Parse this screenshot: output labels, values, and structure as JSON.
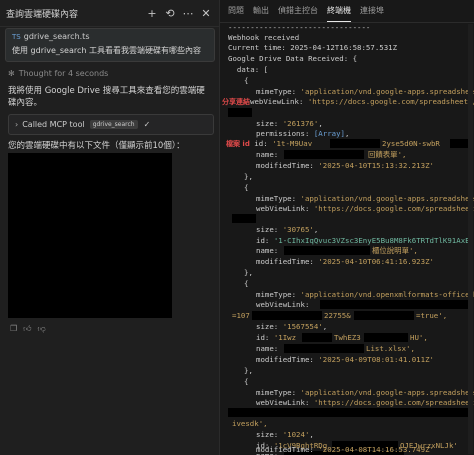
{
  "left": {
    "title": "查詢雲端硬碟內容",
    "icons": [
      "plus-icon",
      "history-icon",
      "more-icon",
      "close-icon"
    ],
    "user_message": {
      "file": "gdrive_search.ts",
      "text": "使用 gdrive_search 工具看看我雲端硬碟有哪些內容"
    },
    "thought": "Thought for 4 seconds",
    "para1": "我將使用 Google Drive 搜尋工具來查看您的雲端硬碟內容。",
    "mcp": {
      "label": "Called MCP tool",
      "tag": "gdrive_search"
    },
    "para2": "您的雲端硬碟中有以下文件（僅顯示前10個）："
  },
  "tabs": [
    {
      "label": "問題",
      "active": false
    },
    {
      "label": "輸出",
      "active": false
    },
    {
      "label": "偵錯主控台",
      "active": false
    },
    {
      "label": "終端機",
      "active": true
    },
    {
      "label": "連接埠",
      "active": false
    }
  ],
  "terminal": {
    "separator": "--------------------------------",
    "l_webhook": "Webhook received",
    "l_time": "Current time: 2025-04-12T16:58:57.531Z",
    "l_gd": "Google Drive Data Received: {",
    "l_data": "  data: [",
    "annotation_share": "分享連結",
    "annotation_id": "檔案 id",
    "f1": {
      "mime": "'application/vnd.google-apps.spreadsheet'",
      "link": "'https://docs.google.com/spreadsheets/",
      "size": "'261376'",
      "perm": "[Array]",
      "id_a": "'1t-M9Uav",
      "id_b": "2yse5d0N-swbR",
      "name": "回饋表單',",
      "mod": "'2025-04-10T15:13:32.213Z'"
    },
    "f2": {
      "mime": "'application/vnd.google-apps.spreadsheet'",
      "link": "'https://docs.google.com/spreadsheets/",
      "size": "'30765'",
      "id": "'1-CIhxIqQvuc3VZsc3EnyE5Bu8M8Fk6TRTdTlK91AxE'",
      "name": "櫃位說明單',",
      "mod": "'2025-04-10T06:41:16.923Z'"
    },
    "f3": {
      "mime": "'application/vnd.openxmlformats-officedoc",
      "link_a": "=107",
      "link_b": "22755&",
      "link_c": "=true',",
      "size": "'1567554'",
      "id_a": "'1Iwz",
      "id_b": "TwhEZ3",
      "id_c": "HU',",
      "name": "List.xlsx',",
      "mod": "'2025-04-09T08:01:41.011Z'"
    },
    "f4": {
      "mime": "'application/vnd.google-apps.spreadsheet'",
      "link": "'https://docs.google.com/spreadsheets/",
      "tail": "ivesdk',",
      "size": "'1024'",
      "id_a": "'1cV9BghtRDg",
      "id_b": "OJEJwrzxNLJk'",
      "mod": "'2025-04-08T14:16:53.749Z'"
    }
  }
}
